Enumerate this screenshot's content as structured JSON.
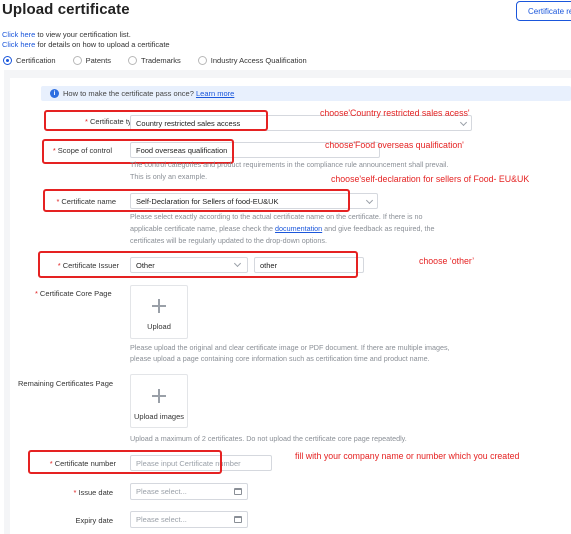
{
  "header": {
    "title": "Upload certificate",
    "top_button": "Certificate re",
    "line1_link": "Click here",
    "line1_text": " to view your certification list.",
    "line2_link": "Click here",
    "line2_text": " for details on how to upload a certificate"
  },
  "tabs": [
    {
      "label": "Certification",
      "selected": true
    },
    {
      "label": "Patents",
      "selected": false
    },
    {
      "label": "Trademarks",
      "selected": false
    },
    {
      "label": "Industry Access Qualification",
      "selected": false
    }
  ],
  "info": {
    "text": "How to make the certificate pass once? ",
    "link": "Learn more"
  },
  "form": {
    "certificate_type": {
      "label": "Certificate type",
      "value": "Country restricted sales access"
    },
    "scope_of_control": {
      "label": "Scope of control",
      "value": "Food overseas qualification",
      "help1": "The control categories and product requirements in the compliance rule announcement shall prevail.",
      "help2": "This is only an example."
    },
    "certificate_name": {
      "label": "Certificate name",
      "value": "Self-Declaration for Sellers of food-EU&UK",
      "help1": "Please select exactly according to the actual certificate name on the certificate. If there is no",
      "help2a": "applicable certificate name, please check the ",
      "help2_link": "documentation",
      "help2b": " and give feedback as required, the",
      "help3": "certificates will be regularly updated to the drop-down options."
    },
    "certificate_issuer": {
      "label": "Certificate Issuer",
      "value": "Other",
      "other_value": "other"
    },
    "core_page": {
      "label": "Certificate Core Page",
      "upload_label": "Upload",
      "help1": "Please upload the original and clear certificate image or PDF document. If there are multiple images,",
      "help2": "please upload a page containing core information such as certification time and product name."
    },
    "remaining_pages": {
      "label": "Remaining Certificates Page",
      "upload_label": "Upload images",
      "help": "Upload a maximum of 2 certificates. Do not upload the certificate core page repeatedly."
    },
    "certificate_number": {
      "label": "Certificate number",
      "placeholder": "Please input Certificate number"
    },
    "issue_date": {
      "label": "Issue date",
      "placeholder": "Please select..."
    },
    "expiry_date": {
      "label": "Expiry date",
      "placeholder": "Please select..."
    }
  },
  "annotations": {
    "type": "choose'Country restricted sales acess'",
    "scope": "choose'Food overseas qualification'",
    "name": "choose'self-declaration for sellers of Food- EU&UK",
    "issuer": "choose ‘other’",
    "number": "fill with your company name or number which you created"
  },
  "colors": {
    "accent": "#1a56db",
    "annotation": "#e52222",
    "required": "#e02020"
  }
}
